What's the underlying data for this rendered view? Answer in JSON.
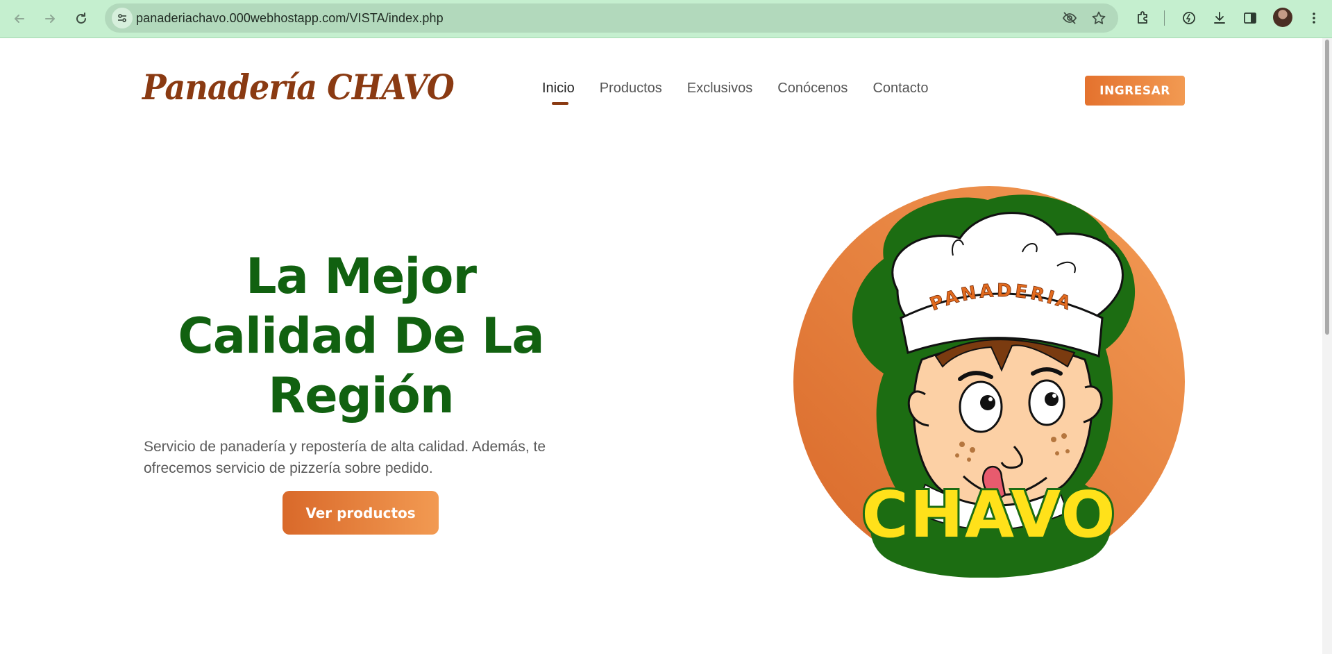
{
  "browser": {
    "url": "panaderiachavo.000webhostapp.com/VISTA/index.php",
    "back_icon": "arrow-left-icon",
    "forward_icon": "arrow-right-icon",
    "reload_icon": "reload-icon",
    "theme_color": "#c5efcf"
  },
  "site": {
    "brand": "Panadería CHAVO",
    "nav": [
      {
        "label": "Inicio",
        "active": true
      },
      {
        "label": "Productos"
      },
      {
        "label": "Exclusivos"
      },
      {
        "label": "Conócenos"
      },
      {
        "label": "Contacto"
      }
    ],
    "login_button": "INGRESAR"
  },
  "hero": {
    "title_lines": [
      "La Mejor",
      "Calidad De La",
      "Región"
    ],
    "description": "Servicio de panadería y repostería de alta calidad. Además, te ofrecemos servicio de pizzería sobre pedido.",
    "cta": "Ver productos",
    "logo": {
      "hat_text": "PANADERIA",
      "name_text": "CHAVO"
    }
  },
  "colors": {
    "brand": "#8a3a12",
    "heading": "#116110",
    "accent": "#e4722e",
    "accent_light": "#f29a52"
  }
}
